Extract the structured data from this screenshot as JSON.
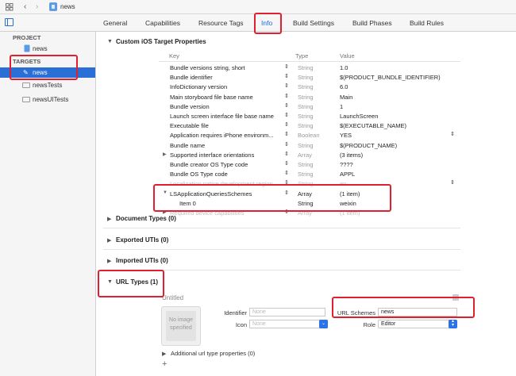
{
  "window": {
    "breadcrumb_project": "news"
  },
  "tabs": [
    {
      "label": "General"
    },
    {
      "label": "Capabilities"
    },
    {
      "label": "Resource Tags"
    },
    {
      "label": "Info"
    },
    {
      "label": "Build Settings"
    },
    {
      "label": "Build Phases"
    },
    {
      "label": "Build Rules"
    }
  ],
  "sidebar": {
    "project_header": "PROJECT",
    "project_item": "news",
    "targets_header": "TARGETS",
    "targets": [
      "news",
      "newsTests",
      "newsUITests"
    ]
  },
  "custom_props": {
    "title": "Custom iOS Target Properties",
    "col_key": "Key",
    "col_type": "Type",
    "col_value": "Value",
    "rows": [
      {
        "key": "Bundle versions string, short",
        "type": "String",
        "value": "1.0"
      },
      {
        "key": "Bundle identifier",
        "type": "String",
        "value": "$(PRODUCT_BUNDLE_IDENTIFIER)"
      },
      {
        "key": "InfoDictionary version",
        "type": "String",
        "value": "6.0"
      },
      {
        "key": "Main storyboard file base name",
        "type": "String",
        "value": "Main"
      },
      {
        "key": "Bundle version",
        "type": "String",
        "value": "1"
      },
      {
        "key": "Launch screen interface file base name",
        "type": "String",
        "value": "LaunchScreen"
      },
      {
        "key": "Executable file",
        "type": "String",
        "value": "$(EXECUTABLE_NAME)"
      },
      {
        "key": "Application requires iPhone environm...",
        "type": "Boolean",
        "value": "YES"
      },
      {
        "key": "Bundle name",
        "type": "String",
        "value": "$(PRODUCT_NAME)"
      },
      {
        "key": "Supported interface orientations",
        "type": "Array",
        "value": "(3 items)"
      },
      {
        "key": "Bundle creator OS Type code",
        "type": "String",
        "value": "????"
      },
      {
        "key": "Bundle OS Type code",
        "type": "String",
        "value": "APPL"
      },
      {
        "key": "Localization native development region",
        "type": "String",
        "value": "en"
      },
      {
        "key": "LSApplicationQueriesSchemes",
        "type": "Array",
        "value": "(1 item)"
      },
      {
        "key": "Item 0",
        "type": "String",
        "value": "weixin"
      },
      {
        "key": "Required device capabilities",
        "type": "Array",
        "value": "(1 item)"
      }
    ]
  },
  "sections": {
    "document_types": "Document Types (0)",
    "exported_utis": "Exported UTIs (0)",
    "imported_utis": "Imported UTIs (0)",
    "url_types": "URL Types (1)"
  },
  "url_type": {
    "title": "Untitled",
    "image_placeholder": "No image specified",
    "identifier_label": "Identifier",
    "identifier_placeholder": "None",
    "icon_label": "Icon",
    "icon_placeholder": "None",
    "url_schemes_label": "URL Schemes",
    "url_schemes_value": "news",
    "role_label": "Role",
    "role_value": "Editor",
    "additional": "Additional url type properties (0)",
    "add_symbol": "+"
  },
  "colors": {
    "selection": "#2a6fd6",
    "annotation": "#e02030",
    "info_tab": "#1a6ae0"
  }
}
